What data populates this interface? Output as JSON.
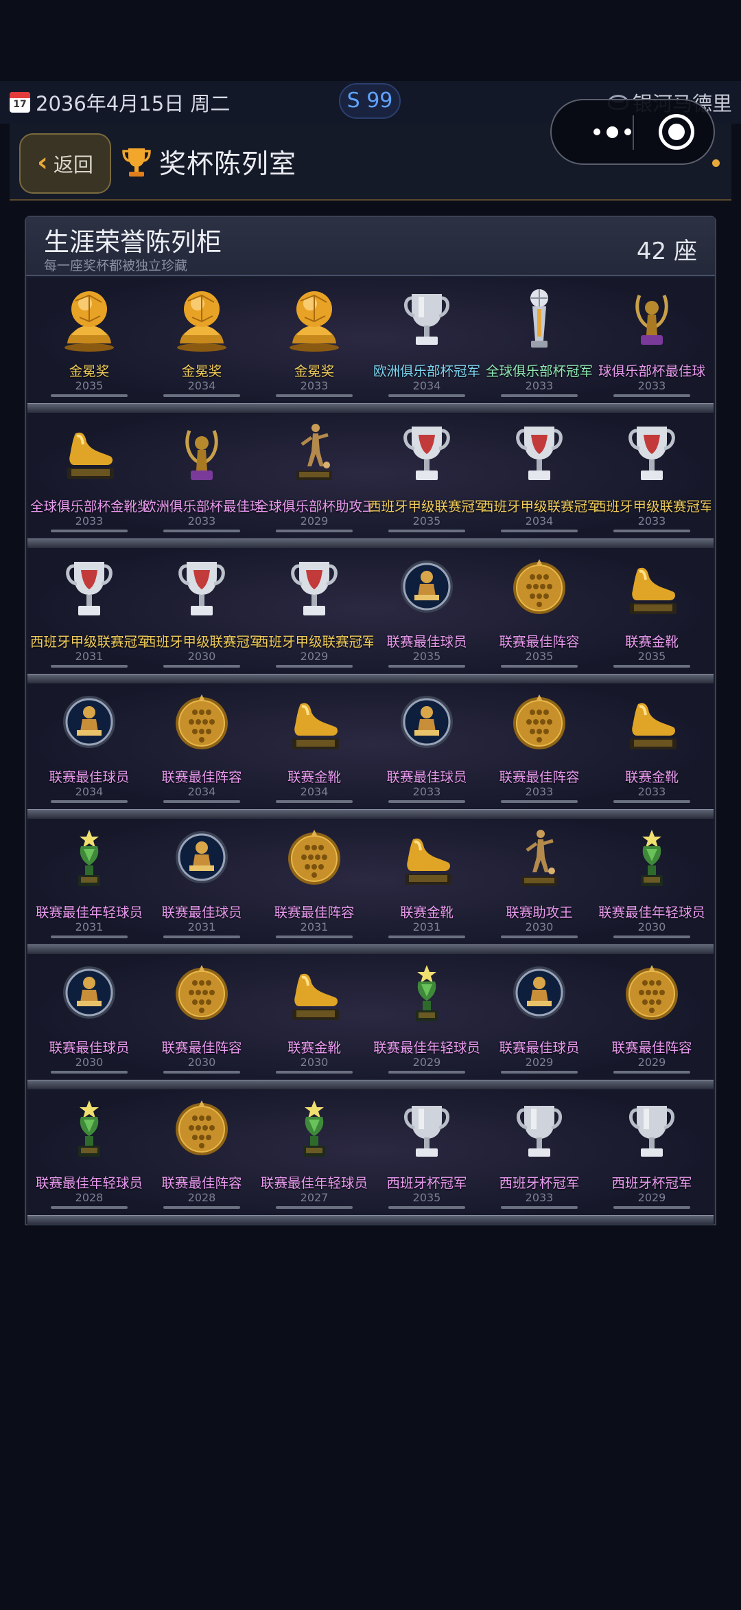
{
  "status_bar": {
    "calendar_day": "17",
    "date": "2036年4月15日 周二",
    "season_badge": "S 99",
    "club": "银河马德里"
  },
  "header": {
    "back_label": "返回",
    "title": "奖杯陈列室"
  },
  "cabinet": {
    "title": "生涯荣誉陈列柜",
    "subtitle": "每一座奖杯都被独立珍藏",
    "count": "42 座"
  },
  "colors": {
    "gold": "#f0cc5a",
    "cyan": "#7fd6f2",
    "green": "#8ee8b2",
    "pink": "#e89aef",
    "accent": "#e8a93a"
  },
  "shelves": [
    [
      {
        "name": "金冕奖",
        "year": "2035",
        "icon": "golden-ball-trophy-icon",
        "color": "gold"
      },
      {
        "name": "金冕奖",
        "year": "2034",
        "icon": "golden-ball-trophy-icon",
        "color": "gold"
      },
      {
        "name": "金冕奖",
        "year": "2033",
        "icon": "golden-ball-trophy-icon",
        "color": "gold"
      },
      {
        "name": "欧洲俱乐部杯冠军",
        "year": "2034",
        "icon": "silver-cup-icon",
        "color": "cyan"
      },
      {
        "name": "全球俱乐部杯冠军",
        "year": "2033",
        "icon": "silver-globe-trophy-icon",
        "color": "green"
      },
      {
        "name": "球俱乐部杯最佳球",
        "year": "2033",
        "icon": "laurel-award-icon",
        "color": "pink"
      }
    ],
    [
      {
        "name": "全球俱乐部杯金靴奖",
        "year": "2033",
        "icon": "golden-boot-icon",
        "color": "pink"
      },
      {
        "name": "欧洲俱乐部杯最佳球员",
        "year": "2033",
        "icon": "laurel-award-icon",
        "color": "pink"
      },
      {
        "name": "全球俱乐部杯助攻王",
        "year": "2029",
        "icon": "player-statue-icon",
        "color": "pink"
      },
      {
        "name": "西班牙甲级联赛冠军",
        "year": "2035",
        "icon": "league-cup-icon",
        "color": "gold"
      },
      {
        "name": "西班牙甲级联赛冠军",
        "year": "2034",
        "icon": "league-cup-icon",
        "color": "gold"
      },
      {
        "name": "西班牙甲级联赛冠军",
        "year": "2033",
        "icon": "league-cup-icon",
        "color": "gold"
      }
    ],
    [
      {
        "name": "西班牙甲级联赛冠军",
        "year": "2031",
        "icon": "league-cup-icon",
        "color": "gold"
      },
      {
        "name": "西班牙甲级联赛冠军",
        "year": "2030",
        "icon": "league-cup-icon",
        "color": "gold"
      },
      {
        "name": "西班牙甲级联赛冠军",
        "year": "2029",
        "icon": "league-cup-icon",
        "color": "gold"
      },
      {
        "name": "联赛最佳球员",
        "year": "2035",
        "icon": "best-player-medal-icon",
        "color": "pink"
      },
      {
        "name": "联赛最佳阵容",
        "year": "2035",
        "icon": "team-medal-icon",
        "color": "pink"
      },
      {
        "name": "联赛金靴",
        "year": "2035",
        "icon": "golden-boot-icon",
        "color": "pink"
      }
    ],
    [
      {
        "name": "联赛最佳球员",
        "year": "2034",
        "icon": "best-player-medal-icon",
        "color": "pink"
      },
      {
        "name": "联赛最佳阵容",
        "year": "2034",
        "icon": "team-medal-icon",
        "color": "pink"
      },
      {
        "name": "联赛金靴",
        "year": "2034",
        "icon": "golden-boot-icon",
        "color": "pink"
      },
      {
        "name": "联赛最佳球员",
        "year": "2033",
        "icon": "best-player-medal-icon",
        "color": "pink"
      },
      {
        "name": "联赛最佳阵容",
        "year": "2033",
        "icon": "team-medal-icon",
        "color": "pink"
      },
      {
        "name": "联赛金靴",
        "year": "2033",
        "icon": "golden-boot-icon",
        "color": "pink"
      }
    ],
    [
      {
        "name": "联赛最佳年轻球员",
        "year": "2031",
        "icon": "young-player-trophy-icon",
        "color": "pink"
      },
      {
        "name": "联赛最佳球员",
        "year": "2031",
        "icon": "best-player-medal-icon",
        "color": "pink"
      },
      {
        "name": "联赛最佳阵容",
        "year": "2031",
        "icon": "team-medal-icon",
        "color": "pink"
      },
      {
        "name": "联赛金靴",
        "year": "2031",
        "icon": "golden-boot-icon",
        "color": "pink"
      },
      {
        "name": "联赛助攻王",
        "year": "2030",
        "icon": "player-statue-icon",
        "color": "pink"
      },
      {
        "name": "联赛最佳年轻球员",
        "year": "2030",
        "icon": "young-player-trophy-icon",
        "color": "pink"
      }
    ],
    [
      {
        "name": "联赛最佳球员",
        "year": "2030",
        "icon": "best-player-medal-icon",
        "color": "pink"
      },
      {
        "name": "联赛最佳阵容",
        "year": "2030",
        "icon": "team-medal-icon",
        "color": "pink"
      },
      {
        "name": "联赛金靴",
        "year": "2030",
        "icon": "golden-boot-icon",
        "color": "pink"
      },
      {
        "name": "联赛最佳年轻球员",
        "year": "2029",
        "icon": "young-player-trophy-icon",
        "color": "pink"
      },
      {
        "name": "联赛最佳球员",
        "year": "2029",
        "icon": "best-player-medal-icon",
        "color": "pink"
      },
      {
        "name": "联赛最佳阵容",
        "year": "2029",
        "icon": "team-medal-icon",
        "color": "pink"
      }
    ],
    [
      {
        "name": "联赛最佳年轻球员",
        "year": "2028",
        "icon": "young-player-trophy-icon",
        "color": "pink"
      },
      {
        "name": "联赛最佳阵容",
        "year": "2028",
        "icon": "team-medal-icon",
        "color": "pink"
      },
      {
        "name": "联赛最佳年轻球员",
        "year": "2027",
        "icon": "young-player-trophy-icon",
        "color": "pink"
      },
      {
        "name": "西班牙杯冠军",
        "year": "2035",
        "icon": "silver-cup-icon",
        "color": "pink"
      },
      {
        "name": "西班牙杯冠军",
        "year": "2033",
        "icon": "silver-cup-icon",
        "color": "pink"
      },
      {
        "name": "西班牙杯冠军",
        "year": "2029",
        "icon": "silver-cup-icon",
        "color": "pink"
      }
    ]
  ]
}
